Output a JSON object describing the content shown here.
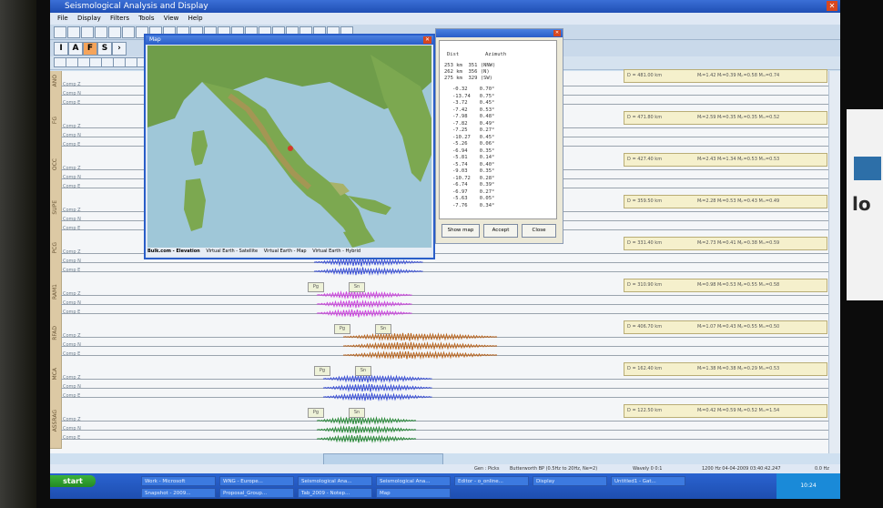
{
  "app": {
    "title": "Seismological Analysis and Display",
    "menu": [
      "File",
      "Display",
      "Filters",
      "Tools",
      "View",
      "Help"
    ]
  },
  "toolbar2": {
    "buttons": [
      "I",
      "A",
      "F",
      "S"
    ]
  },
  "stations": [
    "ANO",
    "FG",
    "OCC",
    "SUPE",
    "PCG",
    "RAM1",
    "RFAD",
    "MCA",
    "ASSRAG"
  ],
  "components": [
    "Comp Z",
    "Comp N",
    "Comp E"
  ],
  "magnitudes": [
    {
      "dist": "D = 481.00 km",
      "vals": "Mₗ=1.42  Mₗ=0.39  Mₚ=0.58  Mₘ=0.74"
    },
    {
      "dist": "D = 471.80 km",
      "vals": "Mₗ=2.59  Mₗ=0.35  Mₚ=0.35  Mₘ=0.52"
    },
    {
      "dist": "D = 427.40 km",
      "vals": "Mₗ=2.43  Mₗ=1.34  Mₚ=0.53  Mₘ=0.53"
    },
    {
      "dist": "D = 359.50 km",
      "vals": "Mₗ=2.28  Mₗ=0.53  Mₚ=0.43  Mₘ=0.49"
    },
    {
      "dist": "D = 331.40 km",
      "vals": "Mₗ=2.73  Mₗ=0.41  Mₚ=0.38  Mₘ=0.59"
    },
    {
      "dist": "D = 310.90 km",
      "vals": "Mₗ=0.98  Mₗ=0.53  Mₚ=0.55  Mₘ=0.58"
    },
    {
      "dist": "D = 406.70 km",
      "vals": "Mₗ=1.07  Mₗ=0.43  Mₚ=0.55  Mₘ=0.50"
    },
    {
      "dist": "D = 162.40 km",
      "vals": "Mₗ=1.38  Mₗ=0.38  Mₚ=0.29  Mₘ=0.53"
    },
    {
      "dist": "D = 122.50 km",
      "vals": "Mₗ=0.42  Mₗ=0.59  Mₚ=0.52  Mₘ=1.54"
    }
  ],
  "picks": [
    "Pg",
    "Sn"
  ],
  "map": {
    "title": "Map",
    "tabs": [
      "Bulk.com - Elevation",
      "Virtual Earth - Satellite",
      "Virtual Earth - Map",
      "Virtual Earth - Hybrid"
    ]
  },
  "distance": {
    "headers": [
      "Dist",
      "Azimuth"
    ],
    "top_rows": [
      "253 km  351 (NNW)",
      "262 km  356 (N)",
      "275 km  329 (SW)"
    ],
    "rows": [
      "-0.32    0.70°",
      "-13.74   0.75°",
      "-3.72    0.45°",
      "-7.42    0.53°",
      "-7.98    0.48°",
      "-7.82    0.49°",
      "-7.25    0.27°",
      "-10.27   0.45°",
      "-5.26    0.06°",
      "-6.94    0.35°",
      "-5.81    0.14°",
      "-5.74    0.40°",
      "-9.03    0.35°",
      "-10.72   0.28°",
      "-6.74    0.39°",
      "-6.97    0.27°",
      "-5.63    0.05°",
      "-7.76    0.34°"
    ],
    "buttons": [
      "Show map",
      "Accept",
      "Close"
    ]
  },
  "status": {
    "items": [
      "Gen : Picks",
      "Butterworth BP (0.5Hz to 20Hz, Ne=2)",
      "Wavely 0 0:1",
      "1200 Hz  04-04-2009  03:40:42.247",
      "0.0 Hz"
    ]
  },
  "taskbar": {
    "start": "start",
    "tasks": [
      "Work - Microsoft",
      "WNG - Europe...",
      "Seismological Ana...",
      "Seismological Ana...",
      "Editor - o_online...",
      "Display",
      "Untitled1 - Gat...",
      "Snapshot - 2009...",
      "Proposal_Group...",
      "Tab_2009 - Notep...",
      "Map"
    ],
    "clock": "10:24"
  },
  "colors": {
    "magenta": "#cc44dd",
    "blue": "#3a4fd6",
    "brown": "#b8641e",
    "green": "#2b8a3a"
  }
}
